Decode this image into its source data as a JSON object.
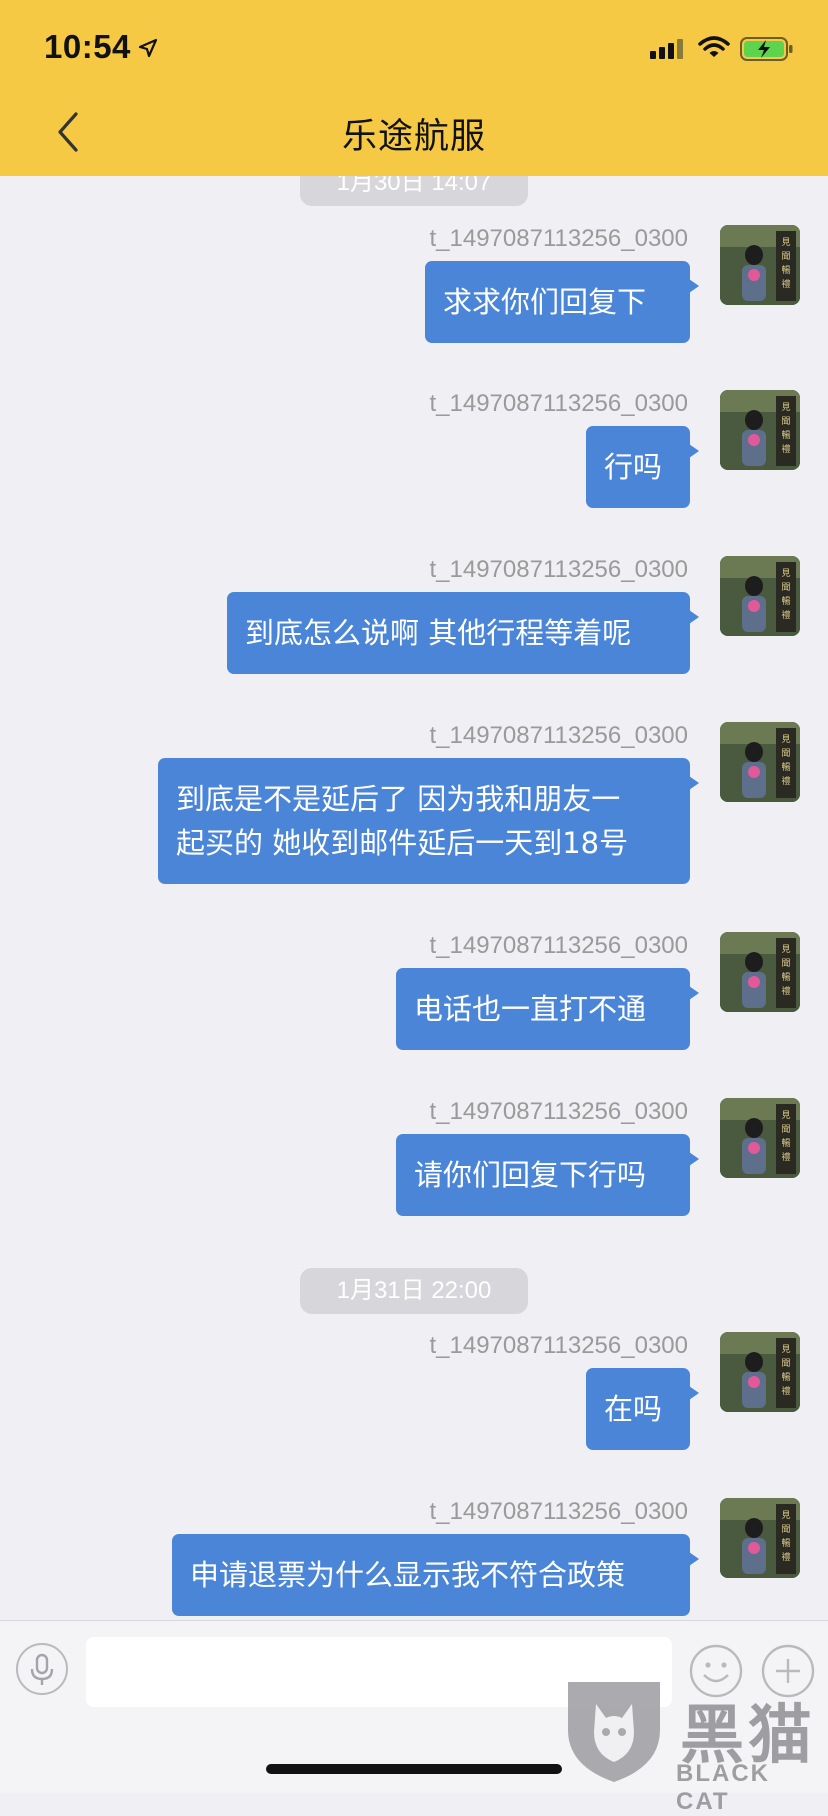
{
  "status_bar": {
    "time": "10:54"
  },
  "header": {
    "title": "乐途航服"
  },
  "timestamps": [
    "1月30日 14:07",
    "1月31日 22:00"
  ],
  "messages": [
    {
      "sender": "t_1497087113256_0300",
      "text": "求求你们回复下"
    },
    {
      "sender": "t_1497087113256_0300",
      "text": "行吗"
    },
    {
      "sender": "t_1497087113256_0300",
      "text": "到底怎么说啊 其他行程等着呢"
    },
    {
      "sender": "t_1497087113256_0300",
      "text": "到底是不是延后了 因为我和朋友一\n起买的 她收到邮件延后一天到18号"
    },
    {
      "sender": "t_1497087113256_0300",
      "text": "电话也一直打不通"
    },
    {
      "sender": "t_1497087113256_0300",
      "text": "请你们回复下行吗"
    },
    {
      "sender": "t_1497087113256_0300",
      "text": "在吗"
    },
    {
      "sender": "t_1497087113256_0300",
      "text": "申请退票为什么显示我不符合政策"
    }
  ],
  "input": {
    "placeholder": "",
    "value": ""
  },
  "watermark": {
    "text": "黑猫",
    "sub": "BLACK CAT"
  },
  "colors": {
    "header": "#f6c945",
    "bubble": "#4a85d8",
    "background": "#efeff4"
  }
}
